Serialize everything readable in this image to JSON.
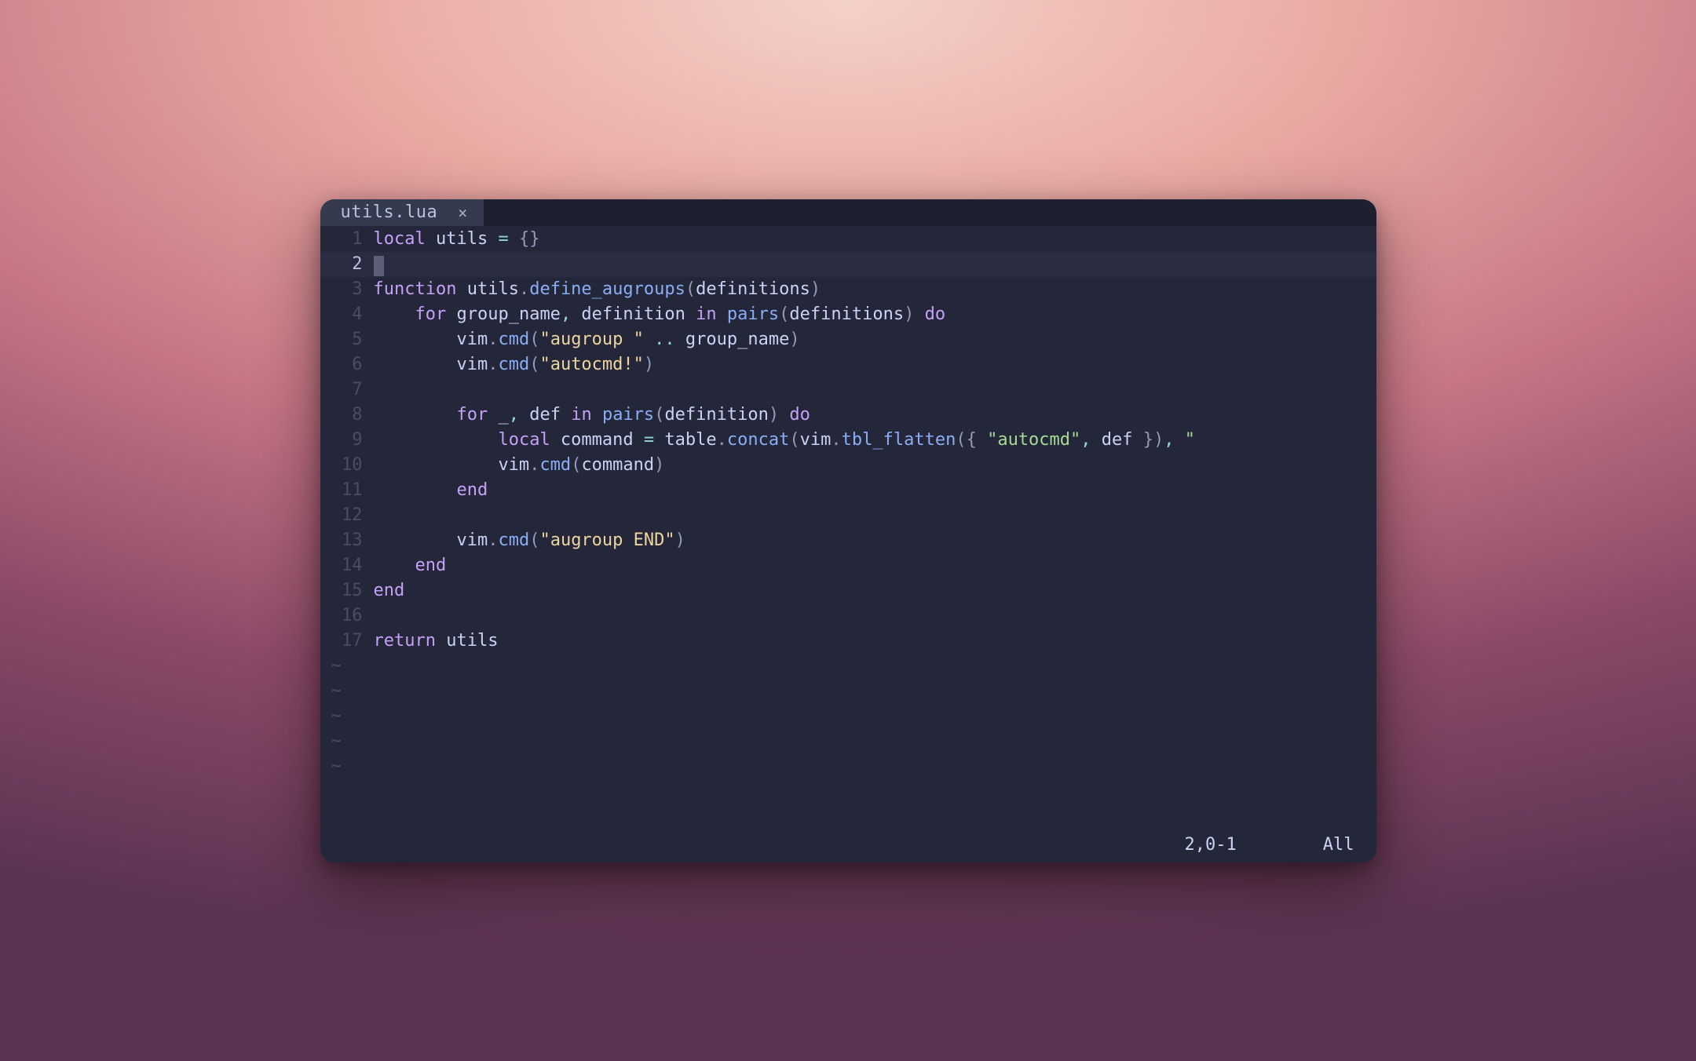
{
  "tab": {
    "filename": "utils.lua",
    "close_glyph": "×"
  },
  "status": {
    "pos": "2,0-1",
    "scroll": "All"
  },
  "tilde": "~",
  "tilde_count": 5,
  "current_line_index": 1,
  "lines": [
    {
      "n": "1",
      "tokens": [
        [
          "kw",
          "local"
        ],
        [
          "id",
          " utils "
        ],
        [
          "op",
          "="
        ],
        [
          "id",
          " "
        ],
        [
          "opg",
          "{}"
        ]
      ]
    },
    {
      "n": "2",
      "tokens": [
        [
          "cursor",
          ""
        ]
      ]
    },
    {
      "n": "3",
      "tokens": [
        [
          "kw",
          "function"
        ],
        [
          "id",
          " "
        ],
        [
          "id",
          "utils"
        ],
        [
          "dot",
          "."
        ],
        [
          "fn",
          "define_augroups"
        ],
        [
          "opg",
          "("
        ],
        [
          "id",
          "definitions"
        ],
        [
          "opg",
          ")"
        ]
      ]
    },
    {
      "n": "4",
      "tokens": [
        [
          "id",
          "    "
        ],
        [
          "kw",
          "for"
        ],
        [
          "id",
          " group_name"
        ],
        [
          "coma",
          ","
        ],
        [
          "id",
          " definition "
        ],
        [
          "kw",
          "in"
        ],
        [
          "id",
          " "
        ],
        [
          "fn",
          "pairs"
        ],
        [
          "opg",
          "("
        ],
        [
          "id",
          "definitions"
        ],
        [
          "opg",
          ")"
        ],
        [
          "id",
          " "
        ],
        [
          "kw",
          "do"
        ]
      ]
    },
    {
      "n": "5",
      "tokens": [
        [
          "id",
          "        vim"
        ],
        [
          "dot",
          "."
        ],
        [
          "fn",
          "cmd"
        ],
        [
          "opg",
          "("
        ],
        [
          "stry",
          "\"augroup \""
        ],
        [
          "id",
          " "
        ],
        [
          "op",
          ".."
        ],
        [
          "id",
          " group_name"
        ],
        [
          "opg",
          ")"
        ]
      ]
    },
    {
      "n": "6",
      "tokens": [
        [
          "id",
          "        vim"
        ],
        [
          "dot",
          "."
        ],
        [
          "fn",
          "cmd"
        ],
        [
          "opg",
          "("
        ],
        [
          "stry",
          "\"autocmd!\""
        ],
        [
          "opg",
          ")"
        ]
      ]
    },
    {
      "n": "7",
      "tokens": []
    },
    {
      "n": "8",
      "tokens": [
        [
          "id",
          "        "
        ],
        [
          "kw",
          "for"
        ],
        [
          "id",
          " _"
        ],
        [
          "coma",
          ","
        ],
        [
          "id",
          " def "
        ],
        [
          "kw",
          "in"
        ],
        [
          "id",
          " "
        ],
        [
          "fn",
          "pairs"
        ],
        [
          "opg",
          "("
        ],
        [
          "id",
          "definition"
        ],
        [
          "opg",
          ")"
        ],
        [
          "id",
          " "
        ],
        [
          "kw",
          "do"
        ]
      ]
    },
    {
      "n": "9",
      "tokens": [
        [
          "id",
          "            "
        ],
        [
          "kw",
          "local"
        ],
        [
          "id",
          " command "
        ],
        [
          "op",
          "="
        ],
        [
          "id",
          " table"
        ],
        [
          "dot",
          "."
        ],
        [
          "fn",
          "concat"
        ],
        [
          "opg",
          "("
        ],
        [
          "id",
          "vim"
        ],
        [
          "dot",
          "."
        ],
        [
          "fn",
          "tbl_flatten"
        ],
        [
          "opg",
          "({ "
        ],
        [
          "str",
          "\"autocmd\""
        ],
        [
          "coma",
          ","
        ],
        [
          "id",
          " def "
        ],
        [
          "opg",
          "})"
        ],
        [
          "coma",
          ","
        ],
        [
          "id",
          " "
        ],
        [
          "str",
          "\""
        ]
      ]
    },
    {
      "n": "10",
      "tokens": [
        [
          "id",
          "            vim"
        ],
        [
          "dot",
          "."
        ],
        [
          "fn",
          "cmd"
        ],
        [
          "opg",
          "("
        ],
        [
          "id",
          "command"
        ],
        [
          "opg",
          ")"
        ]
      ]
    },
    {
      "n": "11",
      "tokens": [
        [
          "id",
          "        "
        ],
        [
          "kw",
          "end"
        ]
      ]
    },
    {
      "n": "12",
      "tokens": []
    },
    {
      "n": "13",
      "tokens": [
        [
          "id",
          "        vim"
        ],
        [
          "dot",
          "."
        ],
        [
          "fn",
          "cmd"
        ],
        [
          "opg",
          "("
        ],
        [
          "stry",
          "\"augroup END\""
        ],
        [
          "opg",
          ")"
        ]
      ]
    },
    {
      "n": "14",
      "tokens": [
        [
          "id",
          "    "
        ],
        [
          "kw",
          "end"
        ]
      ]
    },
    {
      "n": "15",
      "tokens": [
        [
          "kw",
          "end"
        ]
      ]
    },
    {
      "n": "16",
      "tokens": []
    },
    {
      "n": "17",
      "tokens": [
        [
          "kw",
          "return"
        ],
        [
          "id",
          " utils"
        ]
      ]
    }
  ]
}
